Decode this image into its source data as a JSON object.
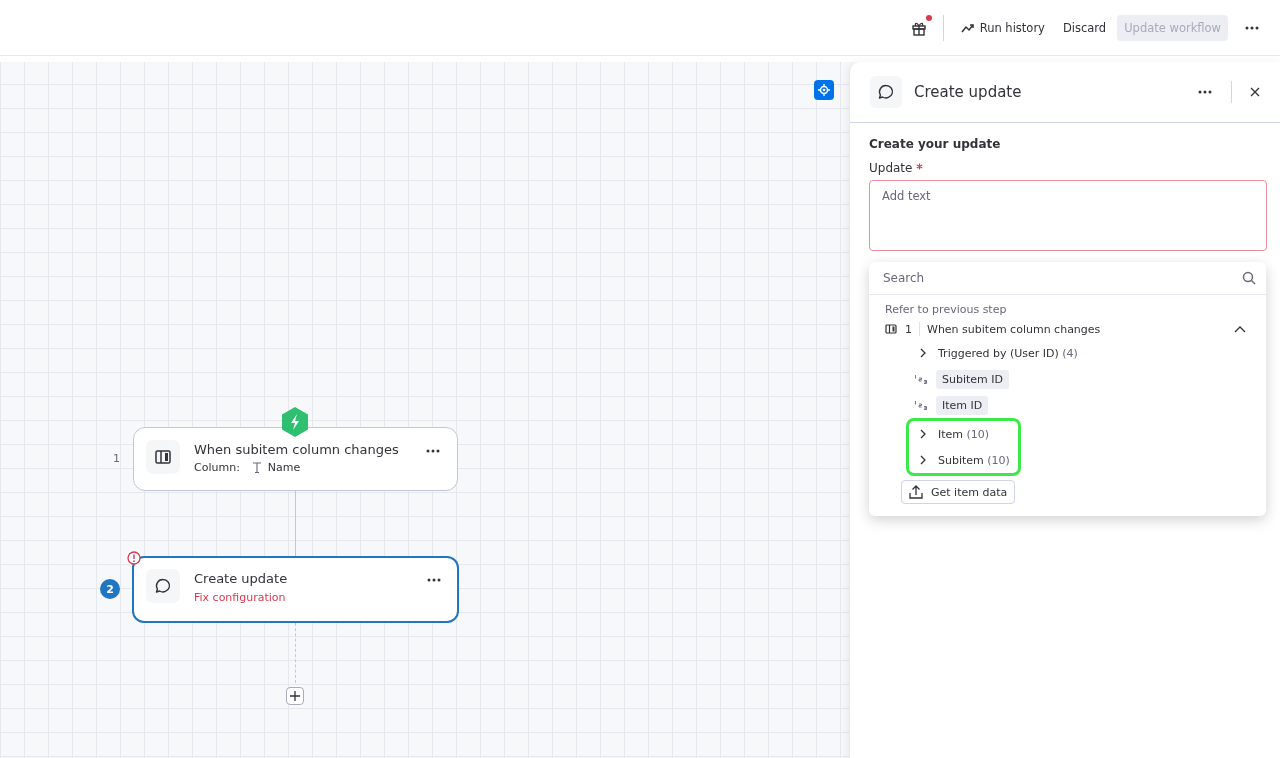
{
  "header": {
    "gift_notification": true,
    "actions": [
      {
        "kind": "history",
        "label": "Run history",
        "disabled": false
      },
      {
        "kind": "plain",
        "label": "Discard",
        "disabled": false
      },
      {
        "kind": "primary",
        "label": "Update workflow",
        "disabled": true
      }
    ]
  },
  "canvas": {
    "nodes": [
      {
        "kind": "trigger",
        "step": "1",
        "title": "When subitem column changes",
        "selected": false,
        "error": false,
        "detail_label": "Column:",
        "detail_value": "Name"
      },
      {
        "kind": "action",
        "step": "2",
        "title": "Create update",
        "selected": true,
        "error": true,
        "status": "Fix configuration"
      }
    ]
  },
  "panel": {
    "title": "Create update",
    "section": "Create your update",
    "field": {
      "label": "Update",
      "required": true,
      "placeholder": "Add text",
      "invalid": true
    },
    "picker": {
      "search_placeholder": "Search",
      "heading": "Refer to previous step",
      "step": {
        "number": "1",
        "title": "When subitem column changes",
        "expanded": true,
        "children": [
          {
            "kind": "group",
            "label": "Triggered by (User ID)",
            "count": "(4)",
            "highlighted": false
          },
          {
            "kind": "number",
            "label": "Subitem ID",
            "highlighted": false
          },
          {
            "kind": "number",
            "label": "Item ID",
            "highlighted": false
          },
          {
            "kind": "group",
            "label": "Item",
            "count": "(10)",
            "highlighted": true
          },
          {
            "kind": "group",
            "label": "Subitem",
            "count": "(10)",
            "highlighted": true
          }
        ]
      },
      "action": "Get item data"
    }
  }
}
